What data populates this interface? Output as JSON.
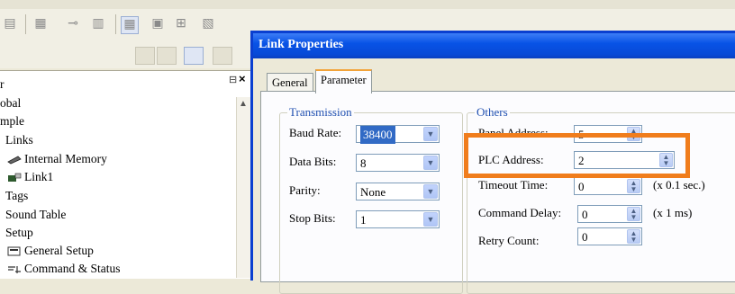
{
  "toolbar": {
    "icons": [
      "list-icon",
      "grid-icon",
      "bar-chart-icon",
      "table-icon",
      "layout-icon",
      "align-icon",
      "align-icon",
      "toolbox-icon",
      "toolbox-icon",
      "toolbox-icon",
      "toolbox-icon",
      "toolbox-icon"
    ]
  },
  "tree": {
    "items": [
      {
        "label": "r",
        "indent": 0
      },
      {
        "label": "obal",
        "indent": 0
      },
      {
        "label": "mple",
        "indent": 0
      },
      {
        "label": "Links",
        "indent": 1
      },
      {
        "label": "Internal Memory",
        "indent": 2,
        "icon": "memory-icon"
      },
      {
        "label": "Link1",
        "indent": 2,
        "icon": "link-icon"
      },
      {
        "label": "Tags",
        "indent": 1
      },
      {
        "label": "Sound Table",
        "indent": 1
      },
      {
        "label": "Setup",
        "indent": 1
      },
      {
        "label": "General Setup",
        "indent": 2,
        "icon": "setup-icon"
      },
      {
        "label": "Command & Status",
        "indent": 2,
        "icon": "command-icon"
      }
    ]
  },
  "dialog": {
    "title": "Link Properties",
    "tabs": [
      "General",
      "Parameter"
    ],
    "active_tab": "Parameter"
  },
  "transmission": {
    "legend": "Transmission",
    "baud_label": "Baud Rate:",
    "baud_value": "38400",
    "databits_label": "Data Bits:",
    "databits_value": "8",
    "parity_label": "Parity:",
    "parity_value": "None",
    "stopbits_label": "Stop Bits:",
    "stopbits_value": "1"
  },
  "others": {
    "legend": "Others",
    "panel_address_label": "Panel Address:",
    "panel_address_value": "5",
    "plc_address_label": "PLC Address:",
    "plc_address_value": "2",
    "timeout_label": "Timeout Time:",
    "timeout_value": "0",
    "timeout_unit": "(x 0.1 sec.)",
    "command_delay_label": "Command Delay:",
    "command_delay_value": "0",
    "command_delay_unit": "(x 1 ms)",
    "retry_label": "Retry Count:",
    "retry_value": "0"
  },
  "colors": {
    "title_bar": "#0853e6",
    "highlight": "#f07d1c",
    "legend_text": "#1f4fb0",
    "selection": "#316ac5"
  }
}
